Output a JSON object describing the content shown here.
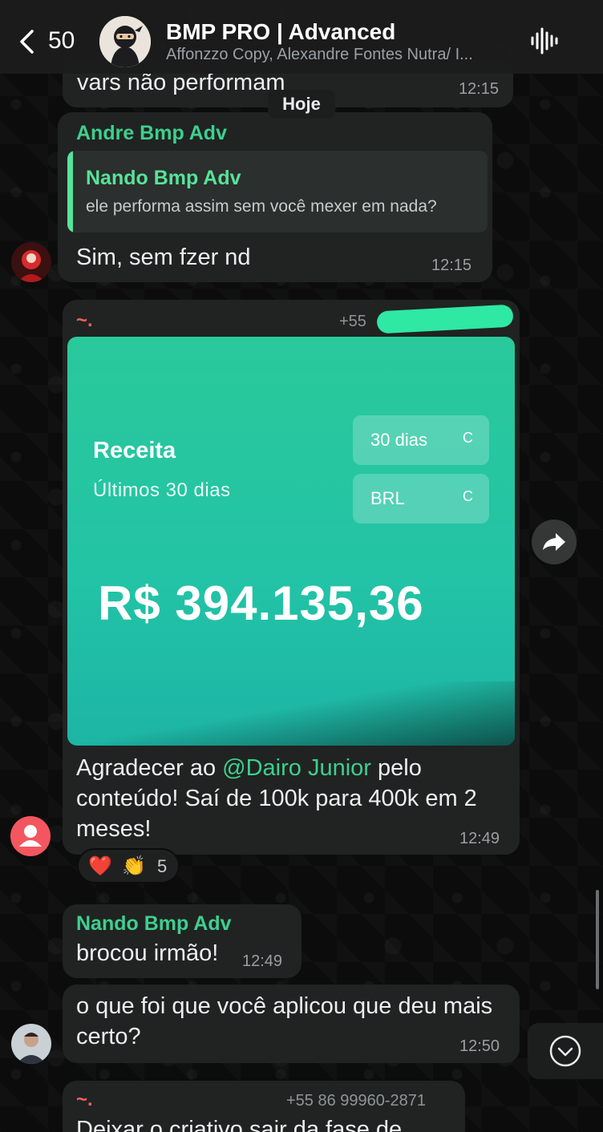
{
  "header": {
    "back_count": "50",
    "title": "BMP PRO | Advanced",
    "members": "Affonzzo Copy, Alexandre Fontes Nutra/ I..."
  },
  "date_separator": "Hoje",
  "messages": [
    {
      "text": "vars não performam",
      "time": "12:15"
    },
    {
      "sender": "Andre Bmp Adv",
      "quote_sender": "Nando Bmp Adv",
      "quote_text": "ele performa assim sem você mexer em nada?",
      "text": "Sim, sem fzer nd",
      "time": "12:15"
    },
    {
      "sender": "~.",
      "phone": "+55",
      "card": {
        "title": "Receita",
        "subtitle": "Últimos 30 dias",
        "period_pill": "30 dias",
        "currency_pill": "BRL",
        "pill_icon": "C",
        "amount": "R$ 394.135,36"
      },
      "text_prefix": "Agradecer ao ",
      "mention": "@Dairo Junior",
      "text_suffix": " pelo conteúdo! Saí de 100k para 400k em 2 meses!",
      "time": "12:49",
      "reactions": {
        "emoji1": "❤️",
        "emoji2": "👏",
        "count": "5"
      }
    },
    {
      "sender": "Nando Bmp Adv",
      "text": "brocou irmão!",
      "time": "12:49"
    },
    {
      "text": "o que foi que você aplicou que deu mais certo?",
      "time": "12:50"
    },
    {
      "sender": "~.",
      "phone": "+55 86 99960-2871",
      "text": "Deixar o criativo sair da fase de"
    }
  ],
  "icons": {
    "back": "chevron-left-icon",
    "audio": "waveform-icon",
    "forward": "forward-arrow-icon",
    "scroll": "chevron-down-icon"
  },
  "colors": {
    "accent_green": "#3ecf8e",
    "card_teal": "#22c3a6",
    "bubble": "#202322"
  }
}
